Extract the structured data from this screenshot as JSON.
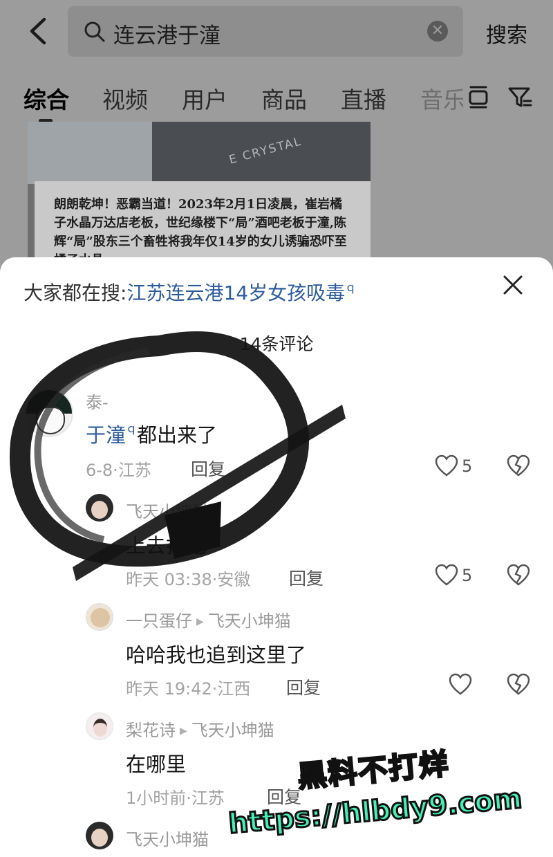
{
  "search": {
    "query": "连云港于潼",
    "button_label": "搜索"
  },
  "tabs": [
    {
      "label": "综合",
      "active": true
    },
    {
      "label": "视频"
    },
    {
      "label": "用户"
    },
    {
      "label": "商品"
    },
    {
      "label": "直播"
    },
    {
      "label": "音乐"
    }
  ],
  "cover": {
    "sign_text": "E CRYSTAL",
    "notice_text": "朗朗乾坤！恶霸当道！2023年2月1日凌晨，崔岩橘子水晶万达店老板，世纪缘楼下“局”酒吧老板于潼,陈辉“局”股东三个畜牲将我年仅14岁的女儿诱骗恐吓至橘子水晶"
  },
  "sheet": {
    "hot_prefix": "大家都在搜:",
    "hot_query": "江苏连云港14岁女孩吸毒",
    "comment_count": "14条评论"
  },
  "comments": {
    "main": {
      "username": "泰-",
      "link_text": "于潼",
      "text": "都出来了",
      "meta": "6-8·江苏",
      "reply": "回复",
      "likes": "5"
    },
    "reply1": {
      "username": "飞天小坤猫",
      "text": "上去打他",
      "meta": "昨天 03:38·安徽",
      "reply": "回复",
      "likes": "5"
    },
    "reply2": {
      "username": "一只蛋仔",
      "reply_to": "飞天小坤猫",
      "text": "哈哈我也追到这里了",
      "meta": "昨天 19:42·江西",
      "reply": "回复"
    },
    "reply3": {
      "username": "梨花诗",
      "reply_to": "飞天小坤猫",
      "text": "在哪里",
      "meta": "1小时前·江苏",
      "reply": "回复"
    },
    "reply4": {
      "username": "飞天小坤猫"
    }
  },
  "watermark": {
    "line1": "黑料不打烊",
    "line2": "https://hlbdy9.com"
  },
  "colors": {
    "link": "#2d5b9c",
    "watermark": "#46f0b4"
  }
}
